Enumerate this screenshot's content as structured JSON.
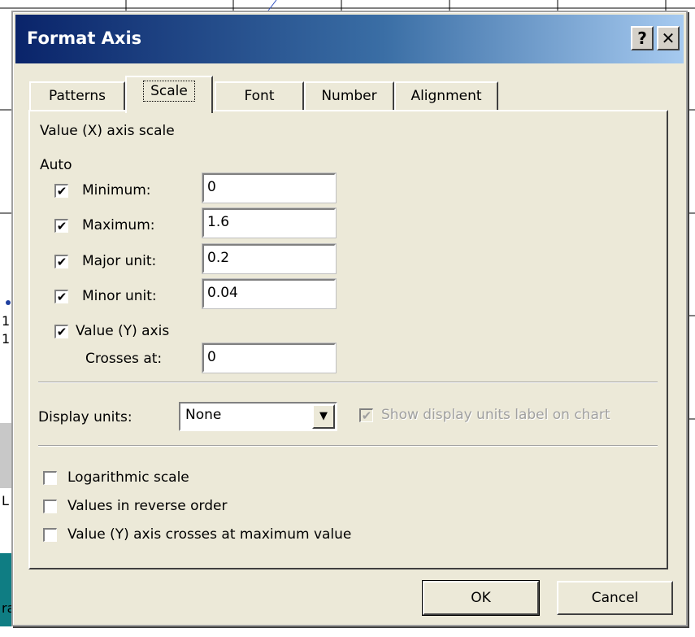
{
  "dialog": {
    "title": "Format Axis",
    "help_label": "?",
    "close_label": "✕"
  },
  "tabs": [
    {
      "label": "Patterns",
      "active": false
    },
    {
      "label": "Scale",
      "active": true
    },
    {
      "label": "Font",
      "active": false
    },
    {
      "label": "Number",
      "active": false
    },
    {
      "label": "Alignment",
      "active": false
    }
  ],
  "scale": {
    "section_title": "Value (X) axis scale",
    "auto_label": "Auto",
    "check_mark": "✔",
    "minimum": {
      "label": "Minimum:",
      "value": "0",
      "auto": true
    },
    "maximum": {
      "label": "Maximum:",
      "value": "1.6",
      "auto": true
    },
    "major_unit": {
      "label": "Major unit:",
      "value": "0.2",
      "auto": true
    },
    "minor_unit": {
      "label": "Minor unit:",
      "value": "0.04",
      "auto": true
    },
    "value_axis": {
      "label": "Value (Y) axis",
      "auto": true
    },
    "crosses_at": {
      "label": "Crosses at:",
      "value": "0"
    },
    "display_units": {
      "label": "Display units:",
      "value": "None",
      "arrow": "▼"
    },
    "show_units_label": {
      "label": "Show display units label on chart",
      "checked": true,
      "enabled": false
    },
    "logarithmic": {
      "label": "Logarithmic scale",
      "checked": false
    },
    "reverse_order": {
      "label": "Values in reverse order",
      "checked": false
    },
    "crosses_at_max": {
      "label": "Value (Y) axis crosses at maximum value",
      "checked": false
    }
  },
  "buttons": {
    "ok": "OK",
    "cancel": "Cancel"
  },
  "background": {
    "fragments": [
      "1",
      "1",
      "L",
      "ra"
    ]
  }
}
